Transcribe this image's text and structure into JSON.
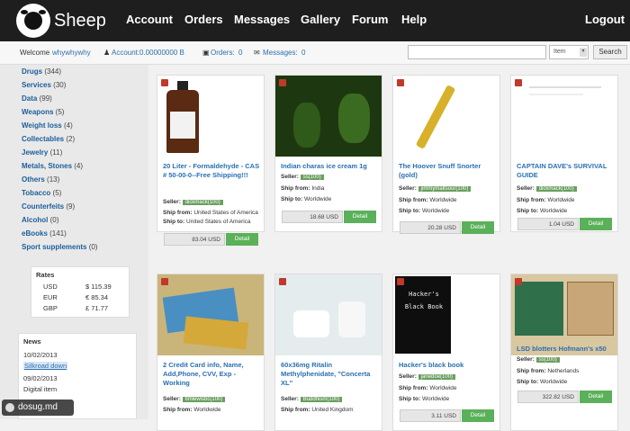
{
  "brand": "Sheep",
  "nav": [
    "Account",
    "Orders",
    "Messages",
    "Gallery",
    "Forum",
    "Help",
    "Logout"
  ],
  "subbar": {
    "welcome": "Welcome",
    "username": "whywhywhy",
    "account_label": "Account:",
    "account_value": "0.00000000 B",
    "orders_label": "Orders:",
    "orders_value": "0",
    "messages_label": "Messages:",
    "messages_value": "0"
  },
  "search": {
    "placeholder": "",
    "select_value": "Item",
    "button": "Search"
  },
  "categories": [
    {
      "name": "Drugs",
      "count": "(344)"
    },
    {
      "name": "Services",
      "count": "(30)"
    },
    {
      "name": "Data",
      "count": "(99)"
    },
    {
      "name": "Weapons",
      "count": "(5)"
    },
    {
      "name": "Weight loss",
      "count": "(4)"
    },
    {
      "name": "Collectables",
      "count": "(2)"
    },
    {
      "name": "Jewelry",
      "count": "(11)"
    },
    {
      "name": "Metals, Stones",
      "count": "(4)"
    },
    {
      "name": "Others",
      "count": "(13)"
    },
    {
      "name": "Tobacco",
      "count": "(5)"
    },
    {
      "name": "Counterfeits",
      "count": "(9)"
    },
    {
      "name": "Alcohol",
      "count": "(0)"
    },
    {
      "name": "eBooks",
      "count": "(141)"
    },
    {
      "name": "Sport supplements",
      "count": "(0)"
    }
  ],
  "rates": {
    "title": "Rates",
    "rows": [
      {
        "cur": "USD",
        "val": "$ 115.39"
      },
      {
        "cur": "EUR",
        "val": "€ 85.34"
      },
      {
        "cur": "GBP",
        "val": "£ 71.77"
      }
    ]
  },
  "news": {
    "title": "News",
    "items": [
      "10/02/2013",
      "Silkroad down",
      "09/02/2013",
      "Digital item"
    ]
  },
  "labels": {
    "seller": "Seller:",
    "ship_from": "Ship from:",
    "ship_to": "Ship to:",
    "detail": "Detail"
  },
  "products": [
    {
      "title": "20 Liter - Formaldehyde - CAS # 50-00-0--Free Shipping!!!",
      "seller": "dickmack(100)",
      "ship_from": "United States of America",
      "ship_to": "United States of America",
      "price": "83.04 USD"
    },
    {
      "title": "Indian charas ice cream 1g",
      "seller": "ss(100)",
      "ship_from": "India",
      "ship_to": "Worldwide",
      "price": "18.68 USD"
    },
    {
      "title": "The Hoover Snuff Snorter (gold)",
      "seller": "jimmymaltsour(100)",
      "ship_from": "Worldwide",
      "ship_to": "Worldwide",
      "price": "20.28 USD"
    },
    {
      "title": "CAPTAIN DAVE's SURVIVAL GUIDE",
      "seller": "dickmack(100)",
      "ship_from": "Worldwide",
      "ship_to": "Worldwide",
      "price": "1.04 USD"
    },
    {
      "title": "2 Credit Card info, Name, Add,Phone, CVV, Exp - Working",
      "seller": "timlewisbc(100)",
      "ship_from": "Worldwide",
      "ship_to": "",
      "price": ""
    },
    {
      "title": "60x36mg Ritalin Methylphenidate, \"Concerta XL\"",
      "seller": "Buddhism(100)",
      "ship_from": "United Kingdom",
      "ship_to": "",
      "price": ""
    },
    {
      "title": "Hacker's black book",
      "seller": "janedoe(100)",
      "ship_from": "Worldwide",
      "ship_to": "Worldwide",
      "price": "3.11 USD"
    },
    {
      "title": "LSD blotters Hofmann's x50",
      "seller": "ss(100)",
      "ship_from": "Netherlands",
      "ship_to": "Worldwide",
      "price": "322.82 USD"
    }
  ],
  "book_cover_text": [
    "Hacker's",
    "Black Book"
  ],
  "watermark": "dosug.md"
}
